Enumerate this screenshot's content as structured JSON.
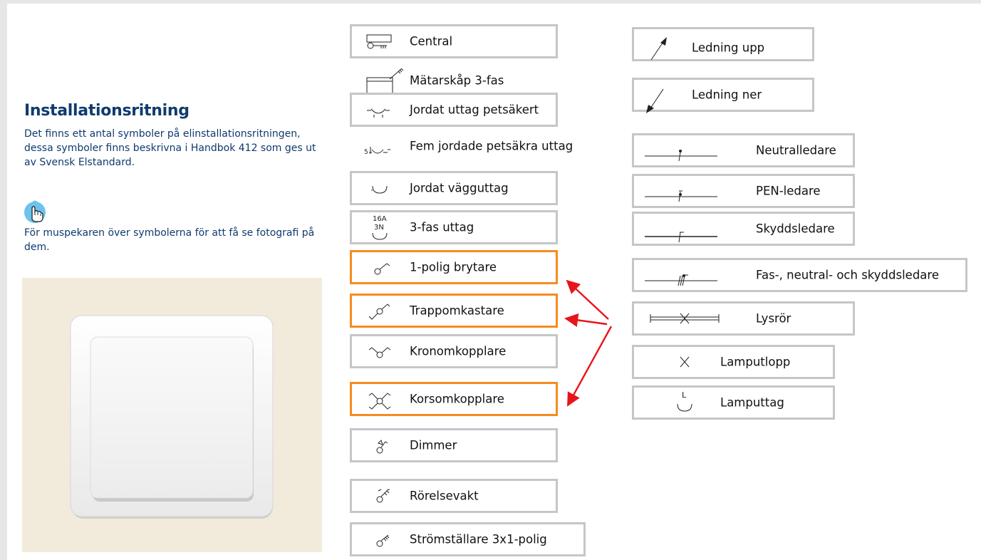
{
  "intro": {
    "title": "Installationsritning",
    "description": "Det finns ett antal symboler på elinstallationsritningen, dessa symboler finns beskrivna i Handbok 412 som ges ut av Svensk Elstandard.",
    "hint": "För muspekaren över symbolerna för att få se fotografi på dem.",
    "hint_icon": "hand-pointer-icon"
  },
  "colors": {
    "title": "#0f3a6e",
    "highlight": "#f68b1f",
    "arrow": "#e8141c",
    "border": "#c6c6c6",
    "photo_bg": "#f2ebdb"
  },
  "symbols_middle": [
    {
      "label": "Central",
      "icon": "central-icon"
    },
    {
      "label": "Mätarskåp 3-fas",
      "icon": "meter-cabinet-icon"
    },
    {
      "label": "Jordat uttag petsäkert",
      "icon": "grounded-outlet-childproof-icon"
    },
    {
      "label": "Fem jordade petsäkra uttag",
      "icon": "five-grounded-outlets-icon"
    },
    {
      "label": "Jordat vägguttag",
      "icon": "grounded-wall-outlet-icon"
    },
    {
      "label": "3-fas uttag",
      "icon": "three-phase-outlet-icon",
      "icon_text": [
        "16A",
        "3N"
      ]
    },
    {
      "label": "1-polig brytare",
      "icon": "single-pole-switch-icon"
    },
    {
      "label": "Trappomkastare",
      "icon": "staircase-switch-icon"
    },
    {
      "label": "Kronomkopplare",
      "icon": "chandelier-switch-icon"
    },
    {
      "label": "Korsomkopplare",
      "icon": "cross-switch-icon"
    },
    {
      "label": "Dimmer",
      "icon": "dimmer-icon"
    },
    {
      "label": "Rörelsevakt",
      "icon": "motion-sensor-icon"
    },
    {
      "label": "Strömställare 3x1-polig",
      "icon": "switch-3x1-pole-icon"
    }
  ],
  "symbols_right": [
    {
      "label": "Ledning upp",
      "icon": "wire-up-icon"
    },
    {
      "label": "Ledning ner",
      "icon": "wire-down-icon"
    },
    {
      "label": "Neutralledare",
      "icon": "neutral-conductor-icon"
    },
    {
      "label": "PEN-ledare",
      "icon": "pen-conductor-icon"
    },
    {
      "label": "Skyddsledare",
      "icon": "protective-conductor-icon"
    },
    {
      "label": "Fas-, neutral- och skyddsledare",
      "icon": "phase-neutral-protective-icon"
    },
    {
      "label": "Lysrör",
      "icon": "fluorescent-tube-icon"
    },
    {
      "label": "Lamputlopp",
      "icon": "lamp-outlet-icon"
    },
    {
      "label": "Lamputtag",
      "icon": "lamp-socket-icon",
      "icon_text": "L"
    }
  ]
}
